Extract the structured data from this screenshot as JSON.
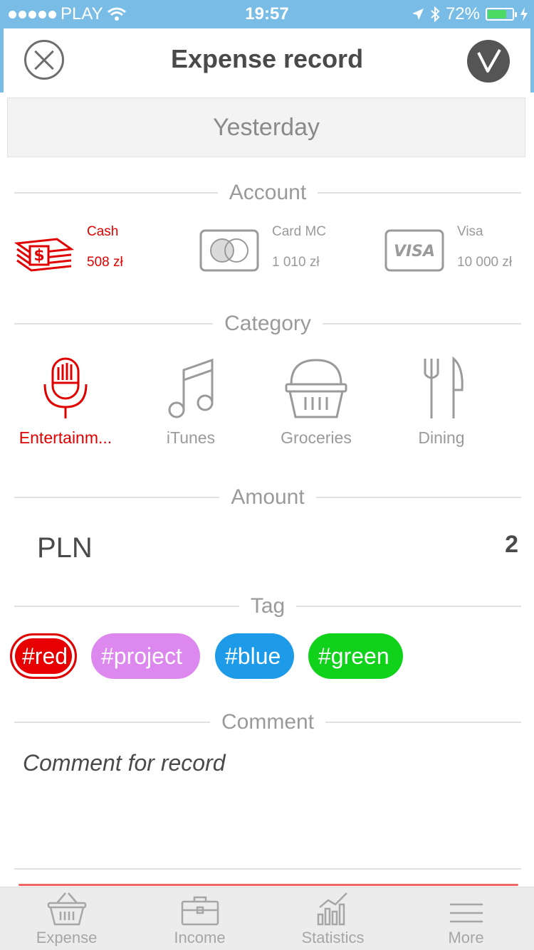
{
  "status_bar": {
    "carrier": "PLAY",
    "time": "19:57",
    "battery": "72%"
  },
  "header": {
    "title": "Expense record"
  },
  "date": {
    "label": "Yesterday"
  },
  "sections": {
    "account": "Account",
    "category": "Category",
    "amount": "Amount",
    "tag": "Tag",
    "comment": "Comment"
  },
  "accounts": [
    {
      "name": "Cash",
      "balance": "508 zł",
      "active": true
    },
    {
      "name": "Card MC",
      "balance": "1 010 zł",
      "active": false
    },
    {
      "name": "Visa",
      "balance": "10 000 zł",
      "active": false
    }
  ],
  "visa_logo_text": "VISA",
  "categories": [
    {
      "label": "Entertainm...",
      "icon": "microphone-icon",
      "active": true
    },
    {
      "label": "iTunes",
      "icon": "music-note-icon",
      "active": false
    },
    {
      "label": "Groceries",
      "icon": "basket-icon",
      "active": false
    },
    {
      "label": "Dining",
      "icon": "fork-knife-icon",
      "active": false
    }
  ],
  "amount": {
    "currency": "PLN",
    "value": "2"
  },
  "tags": [
    {
      "label": "#red",
      "color": "#e60000",
      "selected": true
    },
    {
      "label": "#project",
      "color": "#dd88ee",
      "selected": false
    },
    {
      "label": "#blue",
      "color": "#1e9be8",
      "selected": false
    },
    {
      "label": "#green",
      "color": "#10d21a",
      "selected": false
    }
  ],
  "comment": {
    "placeholder": "Comment for record"
  },
  "tabbar": [
    {
      "label": "Expense",
      "icon": "basket-icon"
    },
    {
      "label": "Income",
      "icon": "briefcase-icon"
    },
    {
      "label": "Statistics",
      "icon": "chart-icon"
    },
    {
      "label": "More",
      "icon": "menu-icon"
    }
  ],
  "colors": {
    "accent_red": "#e00000",
    "status_bar": "#79bde6"
  }
}
